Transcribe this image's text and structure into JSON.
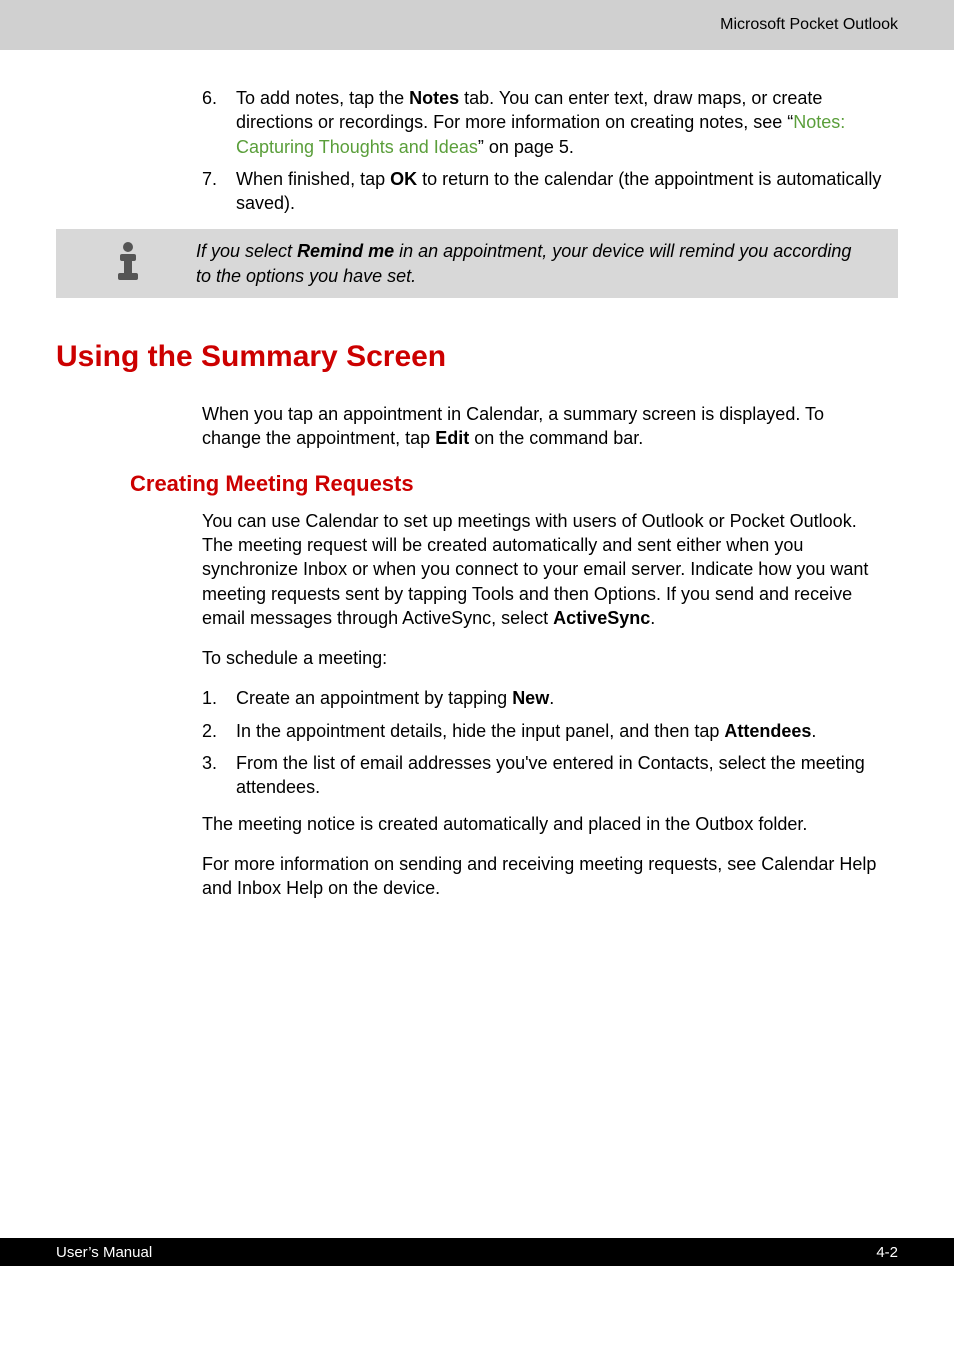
{
  "header": {
    "title": "Microsoft Pocket Outlook"
  },
  "topList": {
    "item6": {
      "num": "6.",
      "t1": "To add notes, tap the ",
      "bold1": "Notes",
      "t2": " tab. You can enter text, draw maps, or create directions or recordings. For more information on creating notes, see “",
      "link": "Notes: Capturing Thoughts and Ideas",
      "t3": "” on page 5."
    },
    "item7": {
      "num": "7.",
      "t1": "When finished, tap ",
      "bold1": " OK ",
      "t2": " to return to the calendar (the appointment is automatically saved)."
    }
  },
  "note": {
    "t1": "If you select ",
    "bold1": " Remind me",
    "t2": " in an appointment, your device will remind you according to the options you have set."
  },
  "section1": {
    "heading": "Using the Summary Screen",
    "p1a": "When you tap an appointment in Calendar, a summary screen is displayed. To change the appointment, tap ",
    "p1bold": "Edit",
    "p1b": " on the command bar."
  },
  "section2": {
    "heading": "Creating Meeting Requests",
    "p1a": "You can use Calendar to set up meetings with users of Outlook or Pocket Outlook. The meeting request will be created automatically and sent either when you synchronize Inbox or when you connect to your email server. Indicate how you want meeting requests sent by tapping Tools and then Options. If you send and receive email messages through ActiveSync, select ",
    "p1bold": "ActiveSync",
    "p1b": ".",
    "p2": "To schedule a meeting:",
    "list": {
      "i1": {
        "num": "1.",
        "t1": "Create an appointment by tapping ",
        "bold1": "New",
        "t2": "."
      },
      "i2": {
        "num": "2.",
        "t1": "In the appointment details, hide the input panel, and then tap ",
        "bold1": "Attendees",
        "t2": "."
      },
      "i3": {
        "num": "3.",
        "t1": "From the list of email addresses you've entered in Contacts, select the meeting attendees."
      }
    },
    "p3": "The meeting notice is created automatically and placed in the Outbox folder.",
    "p4": "For more information on sending and receiving meeting requests, see Calendar Help and Inbox Help on the device."
  },
  "footer": {
    "left": "User’s Manual",
    "right": "4-2"
  }
}
